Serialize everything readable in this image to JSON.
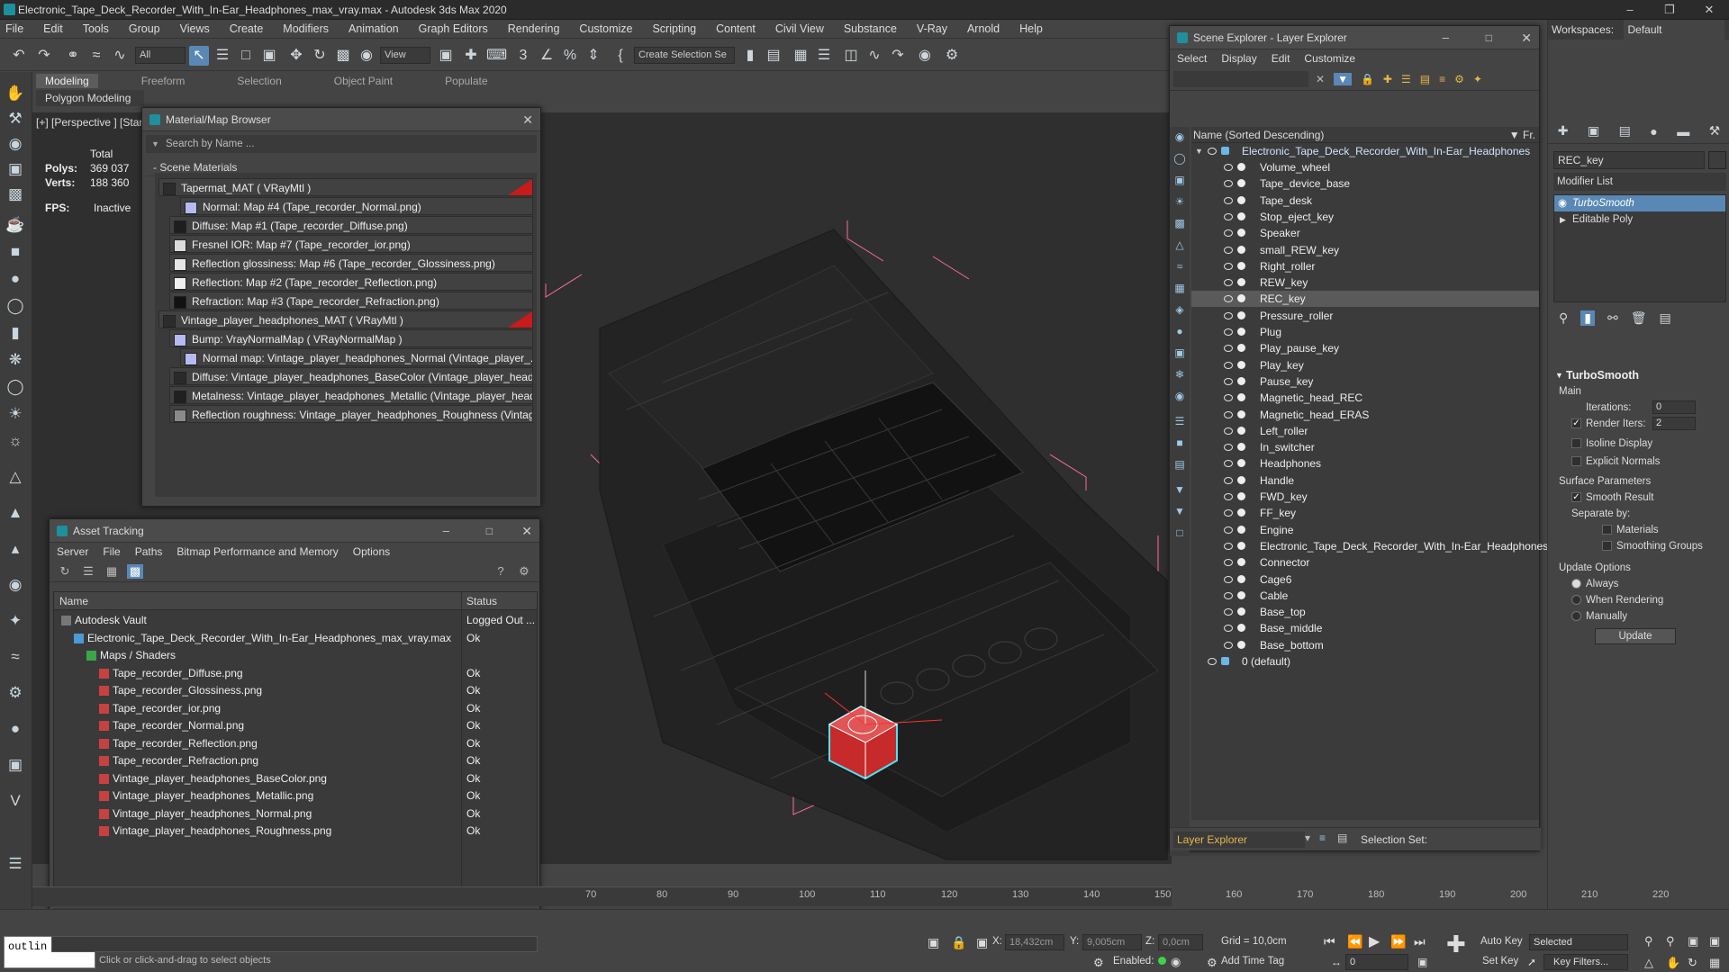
{
  "window": {
    "title": "Electronic_Tape_Deck_Recorder_With_In-Ear_Headphones_max_vray.max - Autodesk 3ds Max 2020"
  },
  "menu": [
    "File",
    "Edit",
    "Tools",
    "Group",
    "Views",
    "Create",
    "Modifiers",
    "Animation",
    "Graph Editors",
    "Rendering",
    "Customize",
    "Scripting",
    "Content",
    "Civil View",
    "Substance",
    "V-Ray",
    "Arnold",
    "Help"
  ],
  "toolbar": {
    "filter": "All",
    "view": "View",
    "selection_set": "Create Selection Se"
  },
  "ribbon": {
    "tabs": [
      "Modeling",
      "Freeform",
      "Selection",
      "Object Paint",
      "Populate"
    ],
    "sub": "Polygon Modeling"
  },
  "viewport": {
    "label": "[+] [Perspective ] [Star",
    "stats": {
      "total": "Total",
      "polys_label": "Polys:",
      "polys": "369 037",
      "verts_label": "Verts:",
      "verts": "188 360",
      "fps_label": "FPS:",
      "fps": "Inactive"
    }
  },
  "material_browser": {
    "title": "Material/Map Browser",
    "search": "Search by Name ...",
    "section": "- Scene Materials",
    "items": [
      {
        "label": "Tapermat_MAT  ( VRayMtl )",
        "level": 0,
        "swatch": "#2c2c2c",
        "flag": true
      },
      {
        "label": "Normal: Map #4 (Tape_recorder_Normal.png)",
        "level": 2,
        "swatch": "#b6b9f2"
      },
      {
        "label": "Diffuse: Map #1 (Tape_recorder_Diffuse.png)",
        "level": 1,
        "swatch": "#1e1e1e"
      },
      {
        "label": "Fresnel IOR: Map #7 (Tape_recorder_ior.png)",
        "level": 1,
        "swatch": "#dcdcdc"
      },
      {
        "label": "Reflection glossiness: Map #6 (Tape_recorder_Glossiness.png)",
        "level": 1,
        "swatch": "#e6e6e6"
      },
      {
        "label": "Reflection: Map #2 (Tape_recorder_Reflection.png)",
        "level": 1,
        "swatch": "#f0f0f0"
      },
      {
        "label": "Refraction: Map #3 (Tape_recorder_Refraction.png)",
        "level": 1,
        "swatch": "#111111"
      },
      {
        "label": "Vintage_player_headphones_MAT  ( VRayMtl )",
        "level": 0,
        "swatch": "#2c2c2c",
        "flag": true
      },
      {
        "label": "Bump: VrayNormalMap  ( VRayNormalMap )",
        "level": 1,
        "swatch": "#b6b9f2"
      },
      {
        "label": "Normal map: Vintage_player_headphones_Normal (Vintage_player_...",
        "level": 2,
        "swatch": "#b6b9f2"
      },
      {
        "label": "Diffuse: Vintage_player_headphones_BaseColor (Vintage_player_headp...",
        "level": 1,
        "swatch": "#2a2a2a"
      },
      {
        "label": "Metalness: Vintage_player_headphones_Metallic (Vintage_player_head...",
        "level": 1,
        "swatch": "#202020"
      },
      {
        "label": "Reflection roughness: Vintage_player_headphones_Roughness (Vintage...",
        "level": 1,
        "swatch": "#8a8a8a"
      }
    ]
  },
  "asset_tracking": {
    "title": "Asset Tracking",
    "menu": [
      "Server",
      "File",
      "Paths",
      "Bitmap Performance and Memory",
      "Options"
    ],
    "columns": {
      "name": "Name",
      "status": "Status"
    },
    "rows": [
      {
        "name": "Autodesk Vault",
        "status": "Logged Out ...",
        "level": 0
      },
      {
        "name": "Electronic_Tape_Deck_Recorder_With_In-Ear_Headphones_max_vray.max",
        "status": "Ok",
        "level": 1
      },
      {
        "name": "Maps / Shaders",
        "status": "",
        "level": 2
      },
      {
        "name": "Tape_recorder_Diffuse.png",
        "status": "Ok",
        "level": 3
      },
      {
        "name": "Tape_recorder_Glossiness.png",
        "status": "Ok",
        "level": 3
      },
      {
        "name": "Tape_recorder_ior.png",
        "status": "Ok",
        "level": 3
      },
      {
        "name": "Tape_recorder_Normal.png",
        "status": "Ok",
        "level": 3
      },
      {
        "name": "Tape_recorder_Reflection.png",
        "status": "Ok",
        "level": 3
      },
      {
        "name": "Tape_recorder_Refraction.png",
        "status": "Ok",
        "level": 3
      },
      {
        "name": "Vintage_player_headphones_BaseColor.png",
        "status": "Ok",
        "level": 3
      },
      {
        "name": "Vintage_player_headphones_Metallic.png",
        "status": "Ok",
        "level": 3
      },
      {
        "name": "Vintage_player_headphones_Normal.png",
        "status": "Ok",
        "level": 3
      },
      {
        "name": "Vintage_player_headphones_Roughness.png",
        "status": "Ok",
        "level": 3
      }
    ]
  },
  "scene_explorer": {
    "title": "Scene Explorer - Layer Explorer",
    "menu": [
      "Select",
      "Display",
      "Edit",
      "Customize"
    ],
    "column": "Name (Sorted Descending)",
    "column_right": "▼ Fr.",
    "root": "Electronic_Tape_Deck_Recorder_With_In-Ear_Headphones",
    "objects": [
      "Volume_wheel",
      "Tape_device_base",
      "Tape_desk",
      "Stop_eject_key",
      "Speaker",
      "small_REW_key",
      "Right_roller",
      "REW_key",
      "REC_key",
      "Pressure_roller",
      "Plug",
      "Play_pause_key",
      "Play_key",
      "Pause_key",
      "Magnetic_head_REC",
      "Magnetic_head_ERAS",
      "Left_roller",
      "In_switcher",
      "Headphones",
      "Handle",
      "FWD_key",
      "FF_key",
      "Engine",
      "Electronic_Tape_Deck_Recorder_With_In-Ear_Headphones",
      "Connector",
      "Cage6",
      "Cable",
      "Base_top",
      "Base_middle",
      "Base_bottom"
    ],
    "selected": "REC_key",
    "default_layer": "0 (default)",
    "footer_mode": "Layer Explorer",
    "footer_selset": "Selection Set:"
  },
  "command_panel": {
    "workspace_label": "Workspaces:",
    "workspace": "Default",
    "object_name": "REC_key",
    "modifier_list": "Modifier List",
    "stack": [
      "TurboSmooth",
      "Editable Poly"
    ],
    "rollout": "TurboSmooth",
    "main": "Main",
    "iterations_label": "Iterations:",
    "iterations": "0",
    "render_iters_label": "Render Iters:",
    "render_iters": "2",
    "isoline": "Isoline Display",
    "explicit": "Explicit Normals",
    "surface": "Surface Parameters",
    "smooth": "Smooth Result",
    "separate": "Separate by:",
    "materials": "Materials",
    "smoothing_groups": "Smoothing Groups",
    "update_options": "Update Options",
    "always": "Always",
    "when_rendering": "When Rendering",
    "manually": "Manually",
    "update": "Update"
  },
  "timeline": {
    "ticks": [
      "70",
      "80",
      "90",
      "100",
      "110",
      "120",
      "130",
      "140",
      "150",
      "160",
      "170",
      "180",
      "190",
      "200",
      "210",
      "220"
    ]
  },
  "status": {
    "maxscript": "outlin",
    "prompt": "Click or click-and-drag to select objects",
    "x_label": "X:",
    "x": "18,432cm",
    "y_label": "Y:",
    "y": "9,005cm",
    "z_label": "Z:",
    "z": "0,0cm",
    "grid": "Grid = 10,0cm",
    "enabled": "Enabled:",
    "add_time_tag": "Add Time Tag",
    "auto_key": "Auto Key",
    "selected": "Selected",
    "set_key": "Set Key",
    "key_filters": "Key Filters...",
    "frame": "0"
  }
}
